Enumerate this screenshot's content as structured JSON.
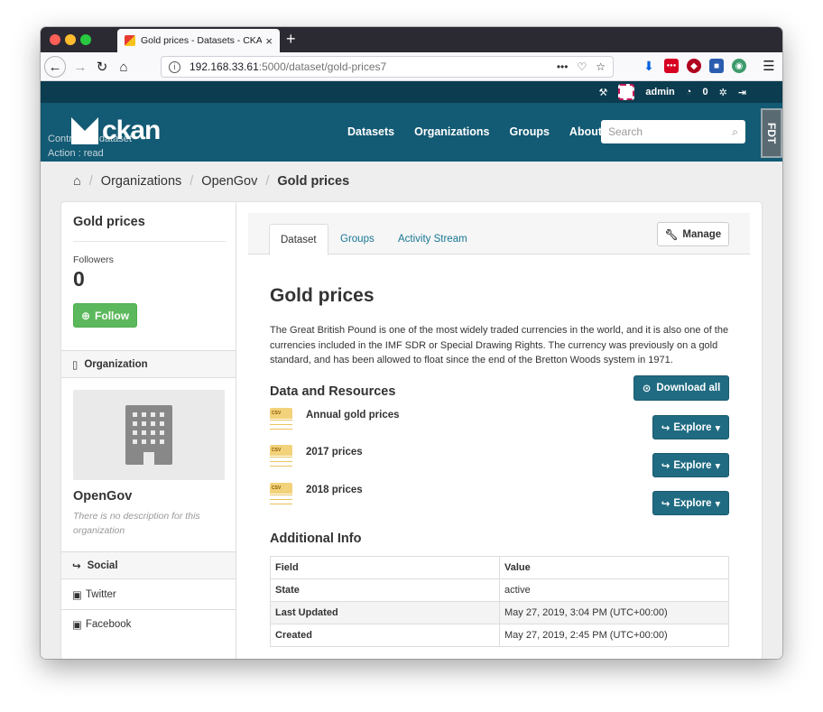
{
  "browser": {
    "tab_title": "Gold prices - Datasets - CKAN",
    "tab_close": "×",
    "new_tab": "+",
    "url_host": "192.168.33.61",
    "url_path": ":5000/dataset/gold-prices7",
    "url_actions": "•••"
  },
  "account": {
    "username": "admin",
    "dashboard_count": "0"
  },
  "masthead": {
    "logo_text": "ckan",
    "debug_line1": "Controller : dataset",
    "debug_line2": "Action : read",
    "nav": [
      "Datasets",
      "Organizations",
      "Groups",
      "About"
    ],
    "search_placeholder": "Search",
    "debug_badge": "FDT"
  },
  "breadcrumb": {
    "items": [
      "Organizations",
      "OpenGov"
    ],
    "current": "Gold prices",
    "separator": "/"
  },
  "sidebar": {
    "dataset_title": "Gold prices",
    "followers_label": "Followers",
    "followers_count": "0",
    "follow_label": "Follow",
    "organization_heading": "Organization",
    "org_name": "OpenGov",
    "org_description": "There is no description for this organization",
    "social_heading": "Social",
    "social_links": [
      "Twitter",
      "Facebook"
    ]
  },
  "tabs": {
    "items": [
      "Dataset",
      "Groups",
      "Activity Stream"
    ],
    "active": "Dataset",
    "manage_label": "Manage"
  },
  "dataset": {
    "title": "Gold prices",
    "notes": "The Great British Pound is one of the most widely traded currencies in the world, and it is also one of the currencies included in the IMF SDR or Special Drawing Rights. The currency was previously on a gold standard, and has been allowed to float since the end of the Bretton Woods system in 1971.",
    "resources_heading": "Data and Resources",
    "download_all_label": "Download all",
    "resources": [
      {
        "name": "Annual gold prices",
        "format": "CSV",
        "action": "Explore"
      },
      {
        "name": "2017 prices",
        "format": "CSV",
        "action": "Explore"
      },
      {
        "name": "2018 prices",
        "format": "CSV",
        "action": "Explore"
      }
    ],
    "additional_info_heading": "Additional Info",
    "info_table": {
      "headers": [
        "Field",
        "Value"
      ],
      "rows": [
        [
          "State",
          "active"
        ],
        [
          "Last Updated",
          "May 27, 2019, 3:04 PM (UTC+00:00)"
        ],
        [
          "Created",
          "May 27, 2019, 2:45 PM (UTC+00:00)"
        ]
      ]
    }
  },
  "colors": {
    "masthead": "#135a74",
    "account_bar": "#0b3c4f",
    "primary_button": "#206b82",
    "follow_button": "#5cb85c",
    "link": "#187794"
  }
}
